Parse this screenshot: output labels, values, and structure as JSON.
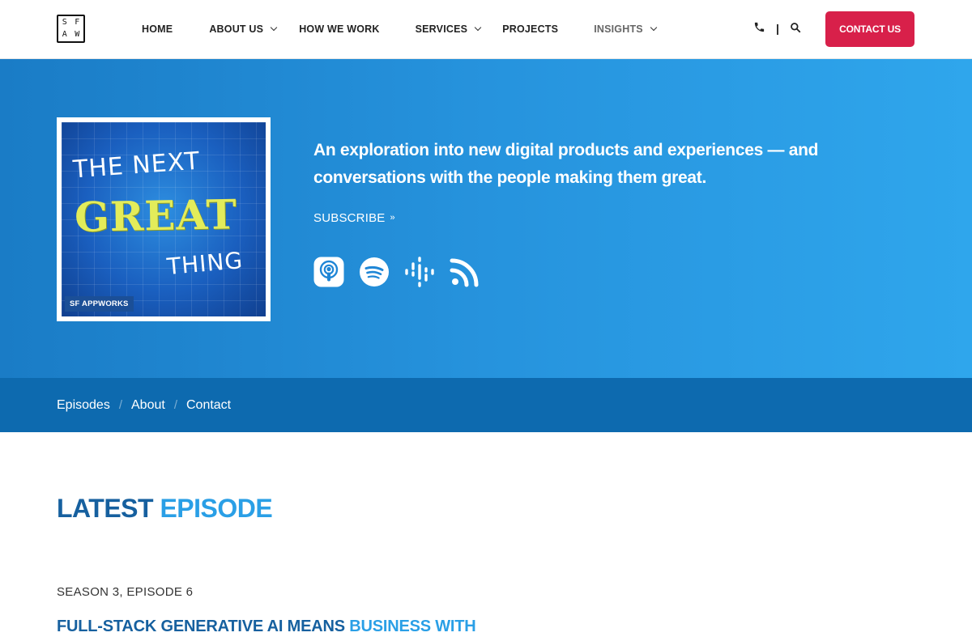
{
  "logo": {
    "letters": [
      "S",
      "F",
      "A",
      "W"
    ]
  },
  "nav": {
    "home": "HOME",
    "about": "ABOUT US",
    "how": "HOW WE WORK",
    "services": "SERVICES",
    "projects": "PROJECTS",
    "insights": "INSIGHTS"
  },
  "header": {
    "contact_button": "CONTACT US"
  },
  "hero": {
    "cover": {
      "line1": "THE NEXT",
      "line2": "GREAT",
      "line3": "THING",
      "brand": "SF APPWORKS"
    },
    "tagline_line1": "An exploration into new digital products and experiences — and",
    "tagline_line2": "conversations with the people making them great.",
    "subscribe": "SUBSCRIBE",
    "podcast_icons": [
      "apple-podcasts-icon",
      "spotify-icon",
      "google-podcasts-icon",
      "rss-icon"
    ]
  },
  "subnav": {
    "episodes": "Episodes",
    "about": "About",
    "contact": "Contact"
  },
  "content": {
    "latest_a": "LATEST",
    "latest_b": "EPISODE",
    "season": "SEASON 3, EPISODE 6",
    "title_a": "FULL-STACK GENERATIVE AI MEANS",
    "title_b": "BUSINESS WITH"
  },
  "colors": {
    "accent": "#d8204a",
    "hero_start": "#1a7cc6",
    "hero_end": "#2fa6ec",
    "subnav": "#0d6aaf",
    "heading_dark": "#16609f",
    "heading_light": "#2a9fe6"
  }
}
